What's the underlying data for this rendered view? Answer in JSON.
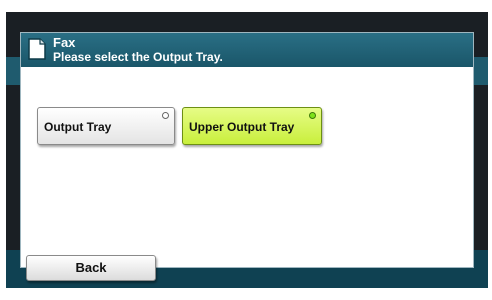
{
  "header": {
    "title": "Fax",
    "subtitle": "Please select the Output Tray.",
    "icon": "document-icon"
  },
  "options": [
    {
      "label": "Output Tray",
      "selected": false
    },
    {
      "label": "Upper Output Tray",
      "selected": true
    }
  ],
  "footer": {
    "back_label": "Back"
  },
  "colors": {
    "header": "#1f5f74",
    "selected_button": "#d4f55a",
    "selected_indicator": "#7ee21a"
  }
}
